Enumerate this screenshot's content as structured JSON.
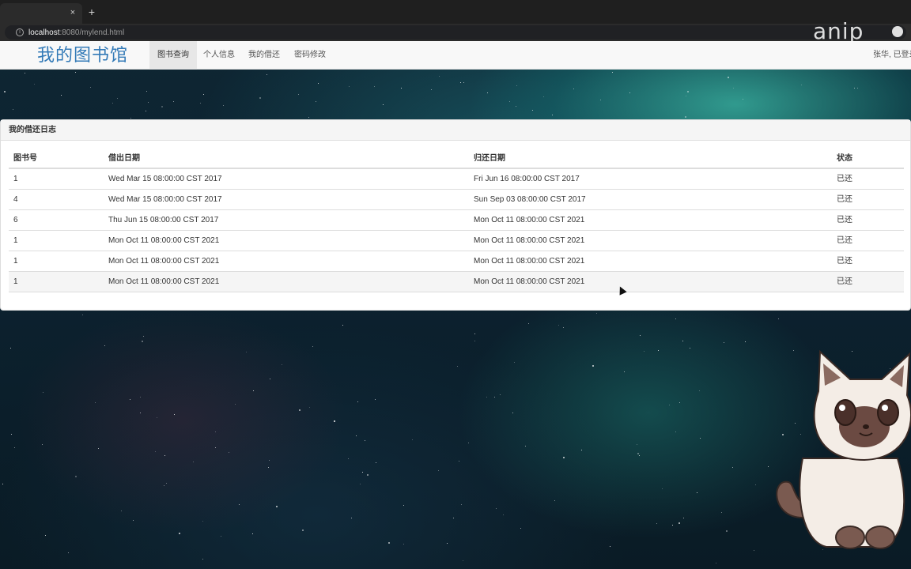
{
  "browser": {
    "tab_close": "×",
    "new_tab": "+",
    "url_host": "localhost",
    "url_rest": ":8080/mylend.html",
    "watermark": "anip"
  },
  "navbar": {
    "brand": "我的图书馆",
    "items": [
      {
        "label": "图书查询",
        "active": true
      },
      {
        "label": "个人信息",
        "active": false
      },
      {
        "label": "我的借还",
        "active": false
      },
      {
        "label": "密码修改",
        "active": false
      }
    ],
    "user_status": "张华, 已登录"
  },
  "panel": {
    "title": "我的借还日志",
    "columns": [
      "图书号",
      "借出日期",
      "归还日期",
      "状态"
    ],
    "rows": [
      {
        "book_id": "1",
        "lend_date": "Wed Mar 15 08:00:00 CST 2017",
        "return_date": "Fri Jun 16 08:00:00 CST 2017",
        "status": "已还"
      },
      {
        "book_id": "4",
        "lend_date": "Wed Mar 15 08:00:00 CST 2017",
        "return_date": "Sun Sep 03 08:00:00 CST 2017",
        "status": "已还"
      },
      {
        "book_id": "6",
        "lend_date": "Thu Jun 15 08:00:00 CST 2017",
        "return_date": "Mon Oct 11 08:00:00 CST 2021",
        "status": "已还"
      },
      {
        "book_id": "1",
        "lend_date": "Mon Oct 11 08:00:00 CST 2021",
        "return_date": "Mon Oct 11 08:00:00 CST 2021",
        "status": "已还"
      },
      {
        "book_id": "1",
        "lend_date": "Mon Oct 11 08:00:00 CST 2021",
        "return_date": "Mon Oct 11 08:00:00 CST 2021",
        "status": "已还"
      },
      {
        "book_id": "1",
        "lend_date": "Mon Oct 11 08:00:00 CST 2021",
        "return_date": "Mon Oct 11 08:00:00 CST 2021",
        "status": "已还"
      }
    ]
  },
  "colors": {
    "brand": "#337ab7",
    "navbar_bg": "#f8f8f8",
    "active_nav_bg": "#e7e7e7"
  }
}
